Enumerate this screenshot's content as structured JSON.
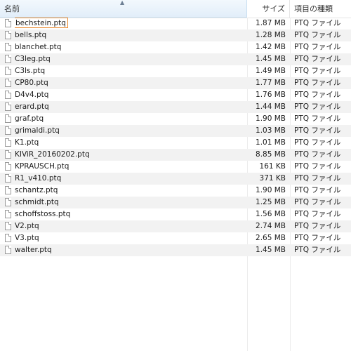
{
  "columns": {
    "name": "名前",
    "size": "サイズ",
    "type": "項目の種類"
  },
  "sort_indicator": "▲",
  "files": [
    {
      "name": "bechstein.ptq",
      "size": "1.87 MB",
      "type": "PTQ ファイル",
      "focused": true
    },
    {
      "name": "bells.ptq",
      "size": "1.28 MB",
      "type": "PTQ ファイル"
    },
    {
      "name": "blanchet.ptq",
      "size": "1.42 MB",
      "type": "PTQ ファイル"
    },
    {
      "name": "C3leg.ptq",
      "size": "1.45 MB",
      "type": "PTQ ファイル"
    },
    {
      "name": "C3ls.ptq",
      "size": "1.49 MB",
      "type": "PTQ ファイル"
    },
    {
      "name": "CP80.ptq",
      "size": "1.77 MB",
      "type": "PTQ ファイル"
    },
    {
      "name": "D4v4.ptq",
      "size": "1.76 MB",
      "type": "PTQ ファイル"
    },
    {
      "name": "erard.ptq",
      "size": "1.44 MB",
      "type": "PTQ ファイル"
    },
    {
      "name": "graf.ptq",
      "size": "1.90 MB",
      "type": "PTQ ファイル"
    },
    {
      "name": "grimaldi.ptq",
      "size": "1.03 MB",
      "type": "PTQ ファイル"
    },
    {
      "name": "K1.ptq",
      "size": "1.01 MB",
      "type": "PTQ ファイル"
    },
    {
      "name": "KIViR_20160202.ptq",
      "size": "8.85 MB",
      "type": "PTQ ファイル"
    },
    {
      "name": "KPRAUSCH.ptq",
      "size": "161 KB",
      "type": "PTQ ファイル"
    },
    {
      "name": "R1_v410.ptq",
      "size": "371 KB",
      "type": "PTQ ファイル"
    },
    {
      "name": "schantz.ptq",
      "size": "1.90 MB",
      "type": "PTQ ファイル"
    },
    {
      "name": "schmidt.ptq",
      "size": "1.25 MB",
      "type": "PTQ ファイル"
    },
    {
      "name": "schoffstoss.ptq",
      "size": "1.56 MB",
      "type": "PTQ ファイル"
    },
    {
      "name": "V2.ptq",
      "size": "2.74 MB",
      "type": "PTQ ファイル"
    },
    {
      "name": "V3.ptq",
      "size": "2.65 MB",
      "type": "PTQ ファイル"
    },
    {
      "name": "walter.ptq",
      "size": "1.45 MB",
      "type": "PTQ ファイル"
    }
  ]
}
